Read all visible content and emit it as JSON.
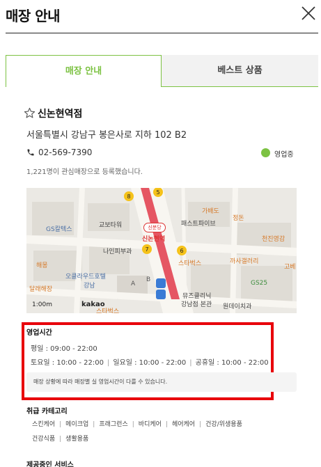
{
  "header": {
    "title": "매장 안내",
    "close_icon": "close-icon"
  },
  "tabs": [
    {
      "label": "매장 안내",
      "active": true
    },
    {
      "label": "베스트 상품",
      "active": false
    }
  ],
  "store": {
    "name": "신논현역점",
    "address": "서울특별시 강남구 봉은사로 지하 102 B2",
    "phone": "02-569-7390",
    "status": "영업중",
    "favorite_count_text": "1,221명이 관심매장으로 등록했습니다."
  },
  "map": {
    "station_name": "신논현역",
    "station_badge": "신분당",
    "scale": "1:00m",
    "brand": "kakao",
    "labels": [
      {
        "text": "GS칼텍스",
        "tone": "blue"
      },
      {
        "text": "교보타워",
        "tone": "default"
      },
      {
        "text": "패스트파이브",
        "tone": "default"
      },
      {
        "text": "가배도",
        "tone": "orange"
      },
      {
        "text": "정돈",
        "tone": "orange"
      },
      {
        "text": "나인피부과",
        "tone": "default"
      },
      {
        "text": "천진영감",
        "tone": "orange"
      },
      {
        "text": "해몽",
        "tone": "orange"
      },
      {
        "text": "오클라우드호텔",
        "tone": "blue"
      },
      {
        "text": "강남",
        "tone": "blue"
      },
      {
        "text": "스타벅스",
        "tone": "orange"
      },
      {
        "text": "까사갤러리",
        "tone": "orange"
      },
      {
        "text": "고베",
        "tone": "orange"
      },
      {
        "text": "달래해장",
        "tone": "orange"
      },
      {
        "text": "뮤즈클리닉",
        "tone": "default"
      },
      {
        "text": "강남점 본관",
        "tone": "default"
      },
      {
        "text": "GS25",
        "tone": "green"
      },
      {
        "text": "원데이치과",
        "tone": "default"
      },
      {
        "text": "스타벅스",
        "tone": "orange"
      }
    ]
  },
  "hours": {
    "title": "영업시간",
    "weekday": "평일 : 09:00 - 22:00",
    "saturday": "토요일 : 10:00 - 22:00",
    "sunday": "일요일 : 10:00 - 22:00",
    "holiday": "공휴일 : 10:00 - 22:00",
    "notice": "매장 상황에 따라 매장별 실 영업시간이 다를 수 있습니다."
  },
  "categories": {
    "title": "취급 카테고리",
    "items": [
      "스킨케어",
      "메이크업",
      "프래그런스",
      "바디케어",
      "헤어케어",
      "건강/위생용품",
      "건강식품",
      "생활용품"
    ]
  },
  "services": {
    "title": "제공중인 서비스"
  },
  "colors": {
    "accent": "#7cc242",
    "highlight": "#e8000b",
    "subway_line": "#e23a4a"
  }
}
